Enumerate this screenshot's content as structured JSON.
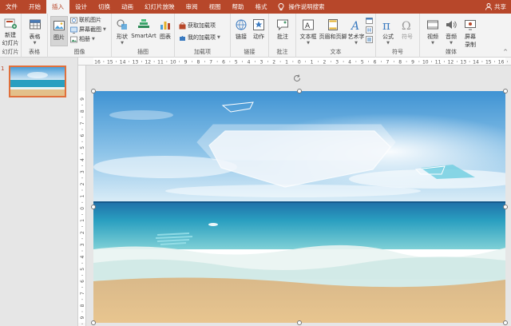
{
  "tabs": [
    "文件",
    "开始",
    "插入",
    "设计",
    "切换",
    "动画",
    "幻灯片放映",
    "审阅",
    "视图",
    "帮助",
    "格式"
  ],
  "active_tab": "插入",
  "tell_me": "操作说明搜索",
  "share": "共享",
  "ribbon": {
    "slides": {
      "new_slide_line1": "新建",
      "new_slide_line2": "幻灯片",
      "group": "幻灯片"
    },
    "tables": {
      "table": "表格",
      "group": "表格"
    },
    "images": {
      "picture": "图片",
      "online_pictures": "联机图片",
      "screenshot": "屏幕截图",
      "album": "相册",
      "group": "图像"
    },
    "illustrations": {
      "shapes": "形状",
      "smartart": "SmartArt",
      "chart": "图表",
      "group": "插图"
    },
    "addins": {
      "get_addins": "获取加载项",
      "my_addins": "我的加载项",
      "group": "加载项"
    },
    "links": {
      "link": "链接",
      "action": "动作",
      "group": "链接"
    },
    "comments": {
      "comment": "批注",
      "group": "批注"
    },
    "text": {
      "textbox": "文本框",
      "header_footer": "页眉和页脚",
      "wordart": "艺术字",
      "group": "文本"
    },
    "symbols": {
      "equation": "公式",
      "symbol": "符号",
      "group": "符号"
    },
    "media": {
      "video": "视频",
      "audio": "音频",
      "screen_recording_line1": "屏幕",
      "screen_recording_line2": "录制",
      "group": "媒体"
    }
  },
  "thumbnail": {
    "number": "1"
  },
  "ruler": {
    "h_ticks": [
      "16",
      "15",
      "14",
      "13",
      "12",
      "11",
      "10",
      "9",
      "8",
      "7",
      "6",
      "5",
      "4",
      "3",
      "2",
      "1",
      "0",
      "1",
      "2",
      "3",
      "4",
      "5",
      "6",
      "7",
      "8",
      "9",
      "10",
      "11",
      "12",
      "13",
      "14",
      "15",
      "16"
    ],
    "v_ticks": [
      "9",
      "8",
      "7",
      "6",
      "5",
      "4",
      "3",
      "2",
      "1",
      "0",
      "1",
      "2",
      "3",
      "4",
      "5",
      "6",
      "7",
      "8",
      "9"
    ]
  },
  "colors": {
    "accent": "#b7472a",
    "selection": "#e0703c",
    "sky_top": "#4a9ed8",
    "sea": "#2a9fc0",
    "sand": "#e3c08a"
  }
}
